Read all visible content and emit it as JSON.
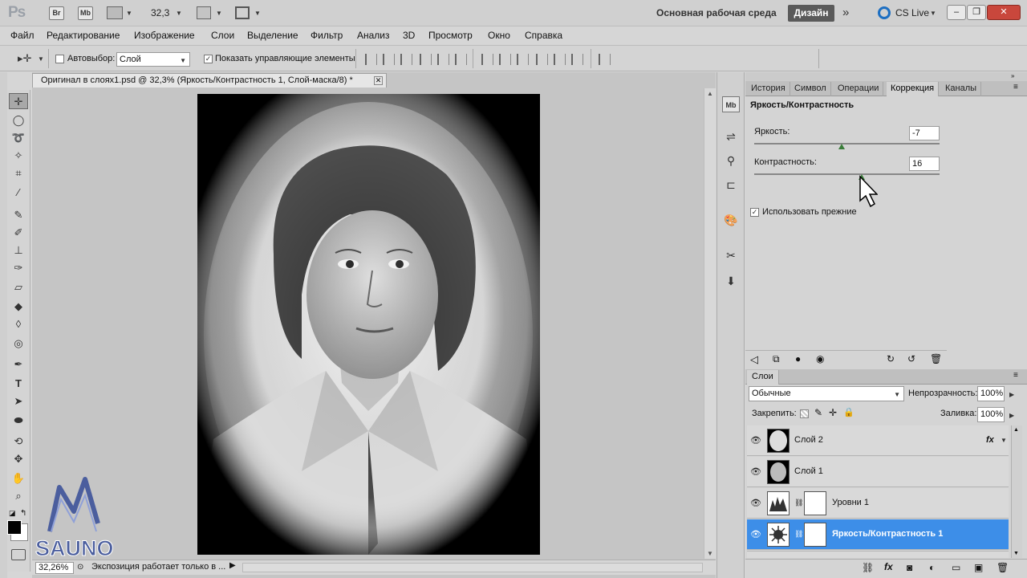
{
  "app": {
    "logo": "Ps",
    "bridge_label": "Br",
    "minibridge_label": "Mb",
    "zoom": "32,3",
    "workspace_label": "Основная рабочая среда",
    "workspace_button": "Дизайн",
    "cs_live": "CS Live"
  },
  "menu": [
    "Файл",
    "Редактирование",
    "Изображение",
    "Слои",
    "Выделение",
    "Фильтр",
    "Анализ",
    "3D",
    "Просмотр",
    "Окно",
    "Справка"
  ],
  "options": {
    "autoselect_label": "Автовыбор:",
    "autoselect_value": "Слой",
    "show_controls_label": "Показать управляющие элементы"
  },
  "document": {
    "tab_title": "Оригинал в слоях1.psd @ 32,3% (Яркость/Контрастность 1, Слой-маска/8) *",
    "status_zoom": "32,26%",
    "status_text": "Экспозиция работает только в ..."
  },
  "adjust_panel": {
    "tabs": [
      "История",
      "Символ",
      "Операции",
      "Коррекция",
      "Каналы"
    ],
    "active_tab": "Коррекция",
    "title": "Яркость/Контрастность",
    "brightness_label": "Яркость:",
    "brightness_value": "-7",
    "brightness_level": 0.47,
    "contrast_label": "Контрастность:",
    "contrast_value": "16",
    "contrast_level": 0.58,
    "legacy_label": "Использовать прежние",
    "legacy_checked": true
  },
  "layers_panel": {
    "tab": "Слои",
    "blend_mode": "Обычные",
    "opacity_label": "Непрозрачность:",
    "opacity_value": "100%",
    "lock_label": "Закрепить:",
    "fill_label": "Заливка:",
    "fill_value": "100%",
    "layers": [
      {
        "name": "Слой 2",
        "fx": "fx",
        "selected": false
      },
      {
        "name": "Слой 1",
        "fx": "",
        "selected": false
      },
      {
        "name": "Уровни 1",
        "fx": "",
        "selected": false
      },
      {
        "name": "Яркость/Контрастность 1",
        "fx": "",
        "selected": true
      }
    ]
  },
  "watermark": "SAUNO",
  "colors": {
    "selection": "#3d8ee8",
    "chrome": "#d4d4d4",
    "dark_button": "#5a5a5a"
  }
}
